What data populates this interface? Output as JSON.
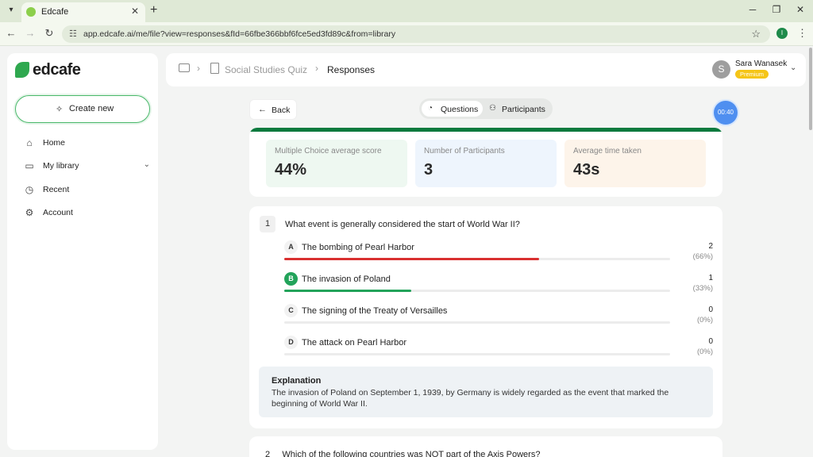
{
  "browser": {
    "tab_title": "Edcafe",
    "url": "app.edcafe.ai/me/file?view=responses&fId=66fbe366bbf6fce5ed3fd89c&from=library",
    "extension_letter": "I"
  },
  "sidebar": {
    "logo_text": "edcafe",
    "create_label": "Create new",
    "items": [
      {
        "label": "Home",
        "icon": "home-icon"
      },
      {
        "label": "My library",
        "icon": "library-icon"
      },
      {
        "label": "Recent",
        "icon": "clock-icon"
      },
      {
        "label": "Account",
        "icon": "gear-icon"
      }
    ]
  },
  "header": {
    "breadcrumb": [
      "Social Studies Quiz",
      "Responses"
    ],
    "user_name": "Sara Wanasek",
    "user_initial": "S",
    "badge": "Premium"
  },
  "controls": {
    "back_label": "Back",
    "tabs": [
      "Questions",
      "Participants"
    ],
    "timer": "00:40"
  },
  "stats": [
    {
      "label": "Multiple Choice average score",
      "value": "44%",
      "color": "#eef8f1"
    },
    {
      "label": "Number of Participants",
      "value": "3",
      "color": "#eef5fd"
    },
    {
      "label": "Average time taken",
      "value": "43s",
      "color": "#fdf4ea"
    }
  ],
  "question1": {
    "number": "1",
    "text": "What event is generally considered the start of World War II?",
    "options": [
      {
        "letter": "A",
        "text": "The bombing of Pearl Harbor",
        "count": "2",
        "pct": "(66%)",
        "fraction": 0.66,
        "color": "#d93030",
        "correct": false
      },
      {
        "letter": "B",
        "text": "The invasion of Poland",
        "count": "1",
        "pct": "(33%)",
        "fraction": 0.33,
        "color": "#22a35a",
        "correct": true
      },
      {
        "letter": "C",
        "text": "The signing of the Treaty of Versailles",
        "count": "0",
        "pct": "(0%)",
        "fraction": 0,
        "color": "#22a35a",
        "correct": false
      },
      {
        "letter": "D",
        "text": "The attack on Pearl Harbor",
        "count": "0",
        "pct": "(0%)",
        "fraction": 0,
        "color": "#22a35a",
        "correct": false
      }
    ],
    "explanation_title": "Explanation",
    "explanation": "The invasion of Poland on September 1, 1939, by Germany is widely regarded as the event that marked the beginning of World War II."
  },
  "question2": {
    "number": "2",
    "text": "Which of the following countries was NOT part of the Axis Powers?"
  }
}
